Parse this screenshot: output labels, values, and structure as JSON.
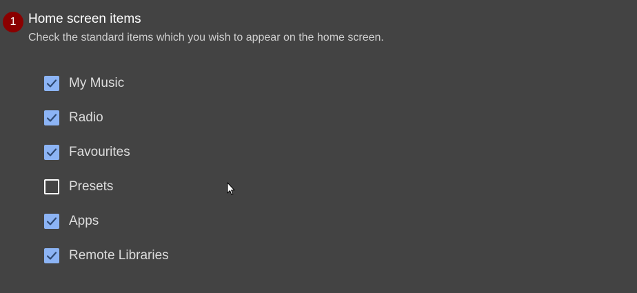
{
  "section": {
    "step_number": "1",
    "title": "Home screen items",
    "description": "Check the standard items which you wish to appear on the home screen."
  },
  "items": [
    {
      "label": "My Music",
      "checked": true
    },
    {
      "label": "Radio",
      "checked": true
    },
    {
      "label": "Favourites",
      "checked": true
    },
    {
      "label": "Presets",
      "checked": false
    },
    {
      "label": "Apps",
      "checked": true
    },
    {
      "label": "Remote Libraries",
      "checked": true
    }
  ],
  "colors": {
    "background": "#434343",
    "badge": "#8a0000",
    "checkbox_checked": "#8cb4f5",
    "checkmark": "#2f4a73"
  },
  "icons": {
    "checkmark": "check-icon",
    "cursor": "mouse-pointer-icon"
  }
}
